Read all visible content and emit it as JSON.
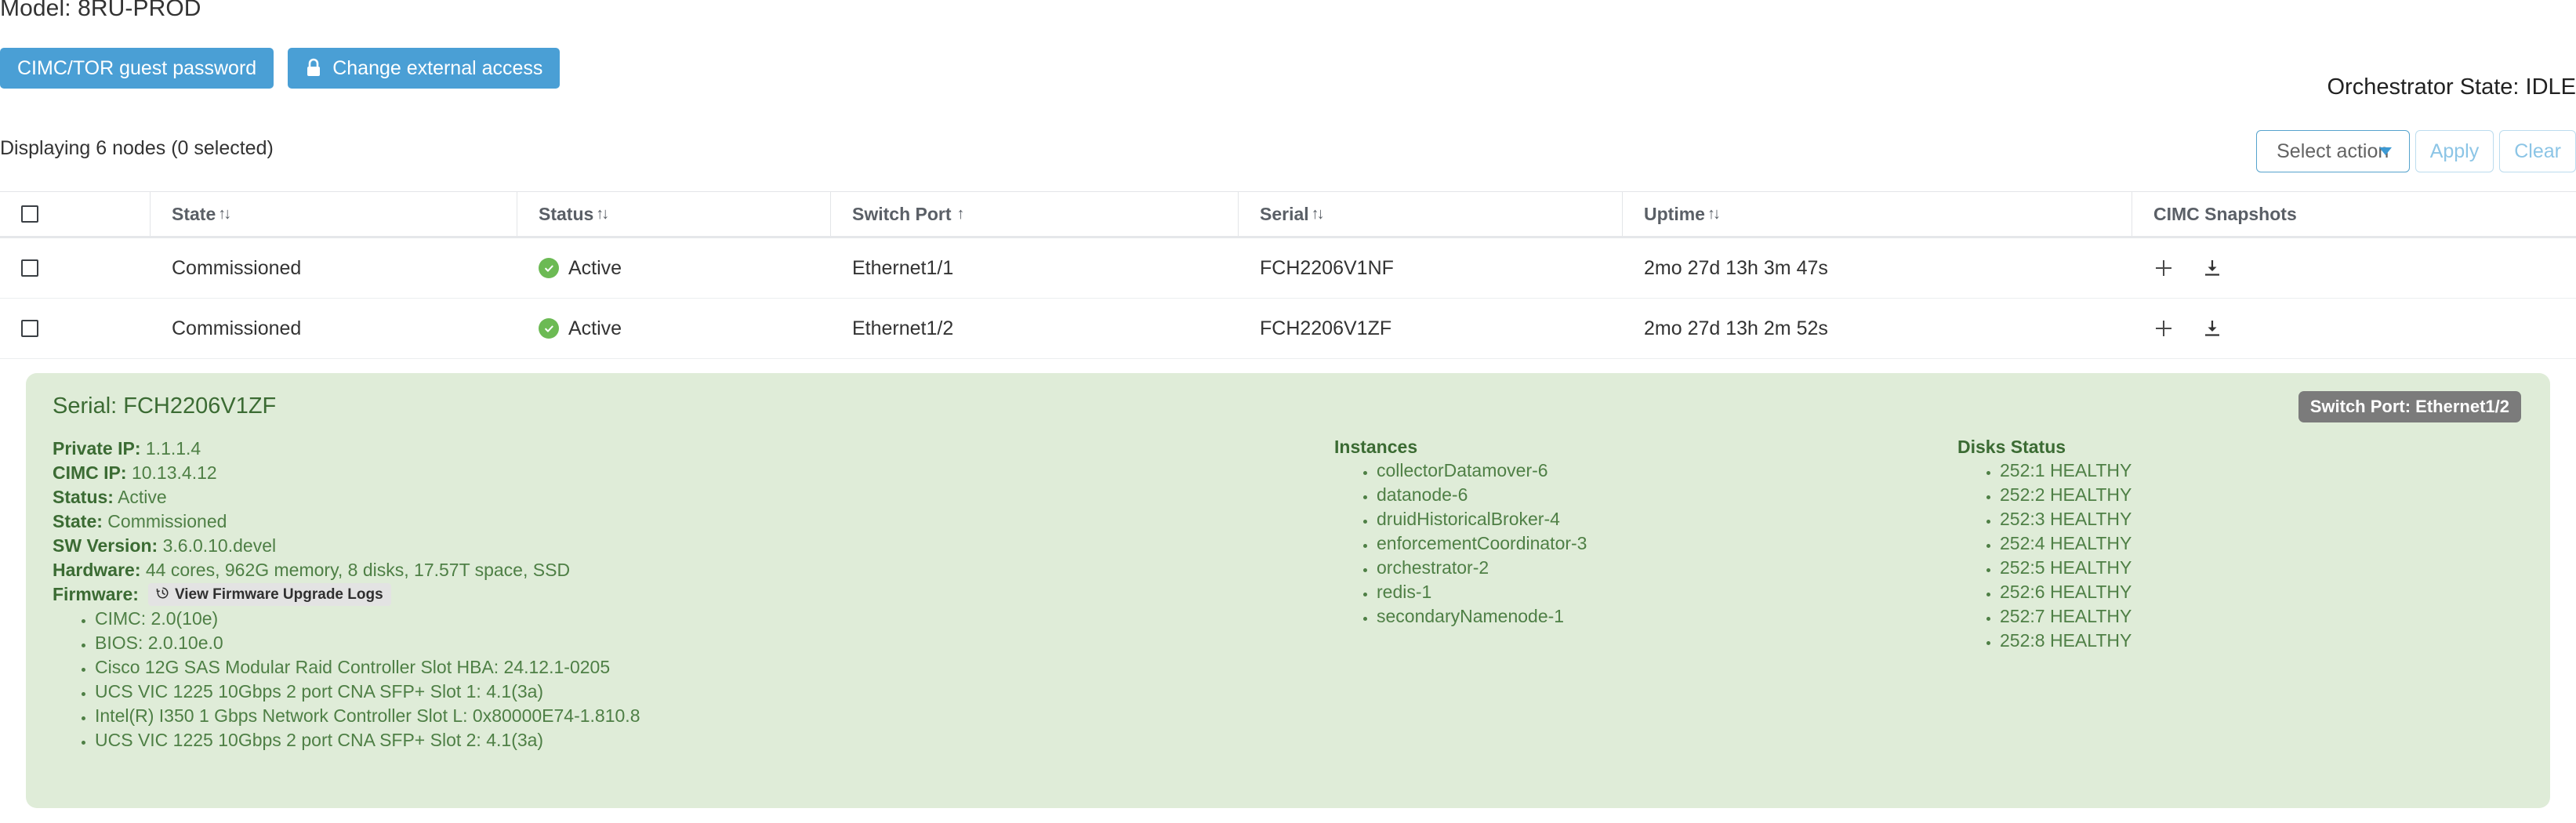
{
  "header": {
    "model_label": "Model: 8RU-PROD",
    "orchestrator_state": "Orchestrator State: IDLE",
    "displaying": "Displaying 6 nodes (0 selected)",
    "buttons": {
      "guest_password": "CIMC/TOR guest password",
      "external_access": "Change external access",
      "lock_icon": "lock-icon"
    }
  },
  "action_bar": {
    "select_action_label": "Select action",
    "caret_icon": "chevron-down-icon",
    "apply_label": "Apply",
    "clear_label": "Clear"
  },
  "table": {
    "columns": [
      {
        "label": "",
        "sort": ""
      },
      {
        "label": "State",
        "sort": "↑↓"
      },
      {
        "label": "Status",
        "sort": "↑↓"
      },
      {
        "label": "Switch Port",
        "sort": "↑"
      },
      {
        "label": "Serial",
        "sort": "↑↓"
      },
      {
        "label": "Uptime",
        "sort": "↑↓"
      },
      {
        "label": "CIMC Snapshots",
        "sort": ""
      }
    ],
    "rows": [
      {
        "state": "Commissioned",
        "status": "Active",
        "switch_port": "Ethernet1/1",
        "serial": "FCH2206V1NF",
        "uptime": "2mo 27d 13h 3m 47s",
        "add_icon": "plus-icon",
        "download_icon": "download-icon"
      },
      {
        "state": "Commissioned",
        "status": "Active",
        "switch_port": "Ethernet1/2",
        "serial": "FCH2206V1ZF",
        "uptime": "2mo 27d 13h 2m 52s",
        "add_icon": "plus-icon",
        "download_icon": "download-icon"
      }
    ]
  },
  "detail": {
    "serial_heading": "Serial: FCH2206V1ZF",
    "port_badge": "Switch Port: Ethernet1/2",
    "fields": [
      {
        "key": "Private IP:",
        "value": "1.1.1.4"
      },
      {
        "key": "CIMC IP:",
        "value": "10.13.4.12"
      },
      {
        "key": "Status:",
        "value": "Active"
      },
      {
        "key": "State:",
        "value": "Commissioned"
      },
      {
        "key": "SW Version:",
        "value": "3.6.0.10.devel"
      },
      {
        "key": "Hardware:",
        "value": "44 cores, 962G memory, 8 disks, 17.57T space, SSD"
      }
    ],
    "firmware_label": "Firmware:",
    "firmware_logs_button": "View Firmware Upgrade Logs",
    "firmware_logs_icon": "history-clock-icon",
    "firmware": [
      "CIMC: 2.0(10e)",
      "BIOS: 2.0.10e.0",
      "Cisco 12G SAS Modular Raid Controller Slot HBA: 24.12.1-0205",
      "UCS VIC 1225 10Gbps 2 port CNA SFP+ Slot 1: 4.1(3a)",
      "Intel(R) I350 1 Gbps Network Controller Slot L: 0x80000E74-1.810.8",
      "UCS VIC 1225 10Gbps 2 port CNA SFP+ Slot 2: 4.1(3a)"
    ],
    "instances_heading": "Instances",
    "instances": [
      "collectorDatamover-6",
      "datanode-6",
      "druidHistoricalBroker-4",
      "enforcementCoordinator-3",
      "orchestrator-2",
      "redis-1",
      "secondaryNamenode-1"
    ],
    "disks_heading": "Disks Status",
    "disks": [
      "252:1 HEALTHY",
      "252:2 HEALTHY",
      "252:3 HEALTHY",
      "252:4 HEALTHY",
      "252:5 HEALTHY",
      "252:6 HEALTHY",
      "252:7 HEALTHY",
      "252:8 HEALTHY"
    ]
  },
  "colors": {
    "accent_blue": "#4a9fd5",
    "panel_green": "#dfecd8",
    "text_green": "#4e7f45",
    "status_green": "#6cba54",
    "badge_gray": "#7b7b7b"
  }
}
